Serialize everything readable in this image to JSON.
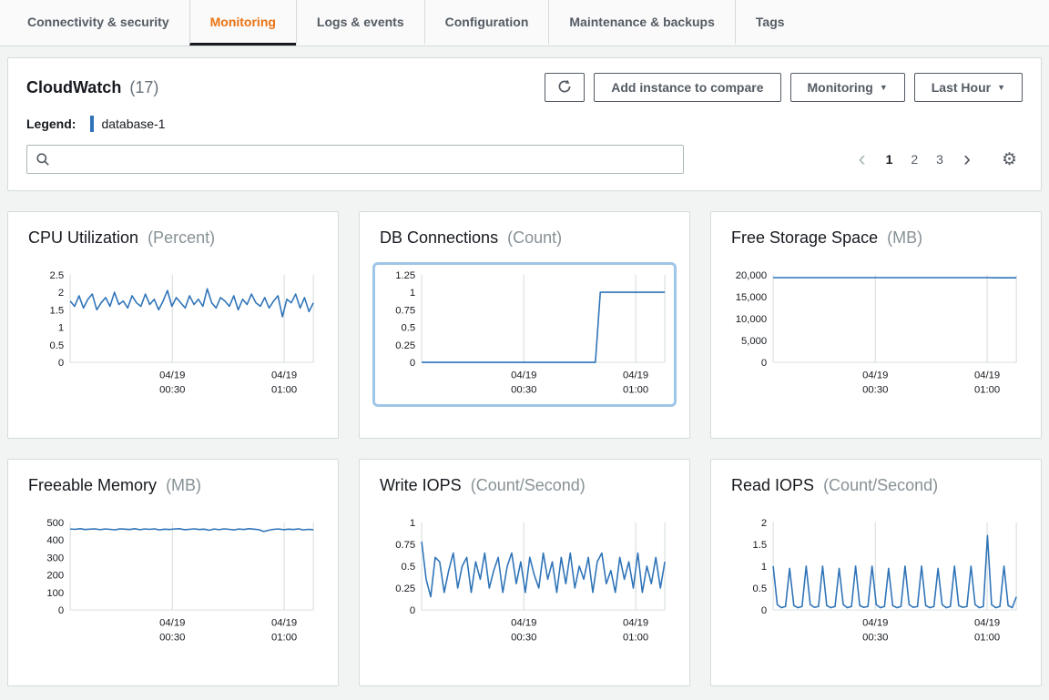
{
  "colors": {
    "accent": "#ec7211",
    "line": "#2e73b8",
    "grid": "#d5dbdb",
    "selected_ring": "#9fc6e8"
  },
  "icons": {
    "caret_down": "▼",
    "gear": "⚙",
    "prev": "‹",
    "next": "›"
  },
  "tabs": {
    "items": [
      {
        "label": "Connectivity & security",
        "active": false
      },
      {
        "label": "Monitoring",
        "active": true
      },
      {
        "label": "Logs & events",
        "active": false
      },
      {
        "label": "Configuration",
        "active": false
      },
      {
        "label": "Maintenance & backups",
        "active": false
      },
      {
        "label": "Tags",
        "active": false
      }
    ]
  },
  "cloudwatch": {
    "title": "CloudWatch",
    "count": "(17)",
    "legend_label": "Legend:",
    "legend_series": "database-1",
    "add_instance_label": "Add instance to compare",
    "monitoring_dropdown_label": "Monitoring",
    "time_range_label": "Last Hour",
    "search_placeholder": "",
    "pagination": {
      "prev": "‹",
      "next": "›",
      "pages": [
        "1",
        "2",
        "3"
      ],
      "current": "1"
    }
  },
  "chart_data": [
    {
      "name": "cpu-utilization",
      "type": "line",
      "title": "CPU Utilization",
      "unit": "(Percent)",
      "ylim": [
        0,
        2.5
      ],
      "yticks": [
        0,
        0.5,
        1,
        1.5,
        2,
        2.5
      ],
      "ytick_labels": [
        "0",
        "0.5",
        "1",
        "1.5",
        "2",
        "2.5"
      ],
      "xticks": [
        {
          "pos": 0.42,
          "date": "04/19",
          "time": "00:30"
        },
        {
          "pos": 0.88,
          "date": "04/19",
          "time": "01:00"
        }
      ],
      "selected": false,
      "values": [
        1.75,
        1.6,
        1.9,
        1.55,
        1.8,
        1.95,
        1.5,
        1.7,
        1.85,
        1.6,
        2.0,
        1.65,
        1.75,
        1.55,
        1.9,
        1.7,
        1.6,
        1.95,
        1.65,
        1.8,
        1.5,
        1.75,
        2.05,
        1.6,
        1.85,
        1.7,
        1.55,
        1.9,
        1.65,
        1.8,
        1.6,
        2.1,
        1.7,
        1.55,
        1.85,
        1.75,
        1.6,
        1.9,
        1.5,
        1.8,
        1.65,
        1.95,
        1.7,
        1.6,
        1.85,
        1.55,
        1.75,
        1.9,
        1.3,
        1.8,
        1.7,
        1.95,
        1.55,
        1.85,
        1.45,
        1.7
      ]
    },
    {
      "name": "db-connections",
      "type": "line",
      "title": "DB Connections",
      "unit": "(Count)",
      "ylim": [
        0,
        1.25
      ],
      "yticks": [
        0,
        0.25,
        0.5,
        0.75,
        1,
        1.25
      ],
      "ytick_labels": [
        "0",
        "0.25",
        "0.5",
        "0.75",
        "1",
        "1.25"
      ],
      "xticks": [
        {
          "pos": 0.42,
          "date": "04/19",
          "time": "00:30"
        },
        {
          "pos": 0.88,
          "date": "04/19",
          "time": "01:00"
        }
      ],
      "selected": true,
      "values": [
        0,
        0,
        0,
        0,
        0,
        0,
        0,
        0,
        0,
        0,
        0,
        0,
        0,
        0,
        0,
        0,
        0,
        0,
        0,
        0,
        0,
        0,
        0,
        0,
        0,
        0,
        0,
        0,
        0,
        0,
        0,
        0,
        0,
        0,
        0,
        0,
        1,
        1,
        1,
        1,
        1,
        1,
        1,
        1,
        1,
        1,
        1,
        1,
        1,
        1
      ]
    },
    {
      "name": "free-storage-space",
      "type": "line",
      "title": "Free Storage Space",
      "unit": "(MB)",
      "ylim": [
        0,
        20000
      ],
      "yticks": [
        0,
        5000,
        10000,
        15000,
        20000
      ],
      "ytick_labels": [
        "0",
        "5,000",
        "10,000",
        "15,000",
        "20,000"
      ],
      "xticks": [
        {
          "pos": 0.42,
          "date": "04/19",
          "time": "00:30"
        },
        {
          "pos": 0.88,
          "date": "04/19",
          "time": "01:00"
        }
      ],
      "selected": false,
      "values": [
        19350,
        19350,
        19350,
        19350,
        19350,
        19350,
        19350,
        19350,
        19350,
        19350,
        19350,
        19350,
        19350,
        19350,
        19350,
        19350,
        19350,
        19350,
        19350,
        19350,
        19350,
        19350,
        19300,
        19300,
        19300
      ]
    },
    {
      "name": "freeable-memory",
      "type": "line",
      "title": "Freeable Memory",
      "unit": "(MB)",
      "ylim": [
        0,
        500
      ],
      "yticks": [
        0,
        100,
        200,
        300,
        400,
        500
      ],
      "ytick_labels": [
        "0",
        "100",
        "200",
        "300",
        "400",
        "500"
      ],
      "xticks": [
        {
          "pos": 0.42,
          "date": "04/19",
          "time": "00:30"
        },
        {
          "pos": 0.88,
          "date": "04/19",
          "time": "01:00"
        }
      ],
      "selected": false,
      "values": [
        462,
        460,
        464,
        459,
        461,
        463,
        458,
        462,
        460,
        457,
        463,
        461,
        459,
        464,
        458,
        462,
        460,
        463,
        457,
        461,
        459,
        462,
        464,
        458,
        460,
        463,
        459,
        461,
        455,
        462,
        458,
        463,
        460,
        457,
        462,
        459,
        464,
        461,
        458,
        448,
        455,
        460,
        462,
        458,
        461,
        459,
        463,
        457,
        460,
        458
      ]
    },
    {
      "name": "write-iops",
      "type": "line",
      "title": "Write IOPS",
      "unit": "(Count/Second)",
      "ylim": [
        0,
        1
      ],
      "yticks": [
        0,
        0.25,
        0.5,
        0.75,
        1
      ],
      "ytick_labels": [
        "0",
        "0.25",
        "0.5",
        "0.75",
        "1"
      ],
      "xticks": [
        {
          "pos": 0.42,
          "date": "04/19",
          "time": "00:30"
        },
        {
          "pos": 0.88,
          "date": "04/19",
          "time": "01:00"
        }
      ],
      "selected": false,
      "values": [
        0.78,
        0.35,
        0.15,
        0.6,
        0.55,
        0.2,
        0.45,
        0.65,
        0.25,
        0.5,
        0.6,
        0.2,
        0.55,
        0.35,
        0.65,
        0.25,
        0.45,
        0.6,
        0.2,
        0.5,
        0.65,
        0.3,
        0.55,
        0.2,
        0.6,
        0.4,
        0.25,
        0.65,
        0.35,
        0.55,
        0.2,
        0.6,
        0.3,
        0.65,
        0.25,
        0.5,
        0.35,
        0.6,
        0.2,
        0.55,
        0.65,
        0.3,
        0.45,
        0.2,
        0.6,
        0.35,
        0.55,
        0.25,
        0.65,
        0.2,
        0.5,
        0.3,
        0.6,
        0.25,
        0.55
      ]
    },
    {
      "name": "read-iops",
      "type": "line",
      "title": "Read IOPS",
      "unit": "(Count/Second)",
      "ylim": [
        0,
        2
      ],
      "yticks": [
        0,
        0.5,
        1,
        1.5,
        2
      ],
      "ytick_labels": [
        "0",
        "0.5",
        "1",
        "1.5",
        "2"
      ],
      "xticks": [
        {
          "pos": 0.42,
          "date": "04/19",
          "time": "00:30"
        },
        {
          "pos": 0.88,
          "date": "04/19",
          "time": "01:00"
        }
      ],
      "selected": false,
      "values": [
        1.0,
        0.12,
        0.05,
        0.08,
        0.95,
        0.1,
        0.05,
        0.08,
        1.0,
        0.12,
        0.06,
        0.08,
        1.0,
        0.1,
        0.05,
        0.08,
        0.95,
        0.12,
        0.05,
        0.08,
        1.0,
        0.1,
        0.06,
        0.08,
        1.0,
        0.12,
        0.05,
        0.08,
        0.95,
        0.1,
        0.05,
        0.08,
        1.0,
        0.12,
        0.06,
        0.08,
        1.0,
        0.1,
        0.05,
        0.08,
        0.95,
        0.12,
        0.05,
        0.08,
        1.0,
        0.1,
        0.06,
        0.08,
        1.0,
        0.12,
        0.05,
        0.08,
        1.7,
        0.12,
        0.05,
        0.08,
        1.0,
        0.1,
        0.05,
        0.3
      ]
    }
  ]
}
